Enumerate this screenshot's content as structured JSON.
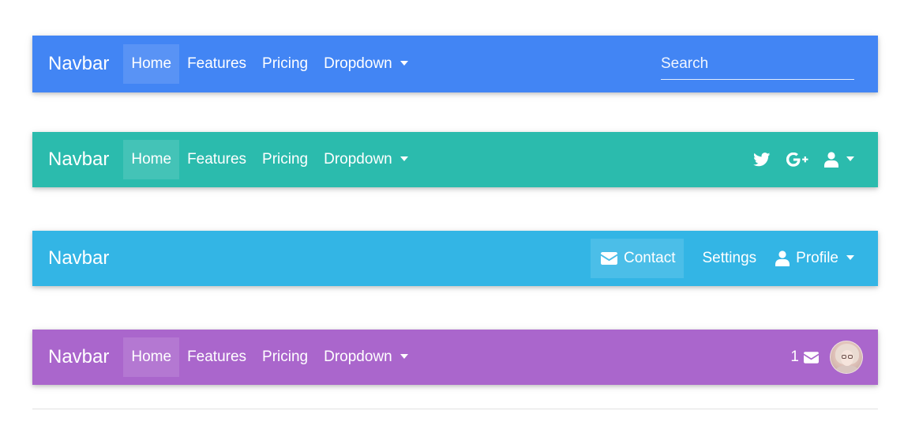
{
  "colors": {
    "navbar1": "#4285f4",
    "navbar2": "#2bbbad",
    "navbar3": "#33b5e5",
    "navbar4": "#aa66cc"
  },
  "navbar1": {
    "brand": "Navbar",
    "links": [
      "Home",
      "Features",
      "Pricing",
      "Dropdown"
    ],
    "search_placeholder": "Search"
  },
  "navbar2": {
    "brand": "Navbar",
    "links": [
      "Home",
      "Features",
      "Pricing",
      "Dropdown"
    ],
    "icons": [
      "twitter-icon",
      "google-plus-icon",
      "user-icon"
    ]
  },
  "navbar3": {
    "brand": "Navbar",
    "contact": "Contact",
    "settings": "Settings",
    "profile": "Profile"
  },
  "navbar4": {
    "brand": "Navbar",
    "links": [
      "Home",
      "Features",
      "Pricing",
      "Dropdown"
    ],
    "message_count": "1"
  }
}
